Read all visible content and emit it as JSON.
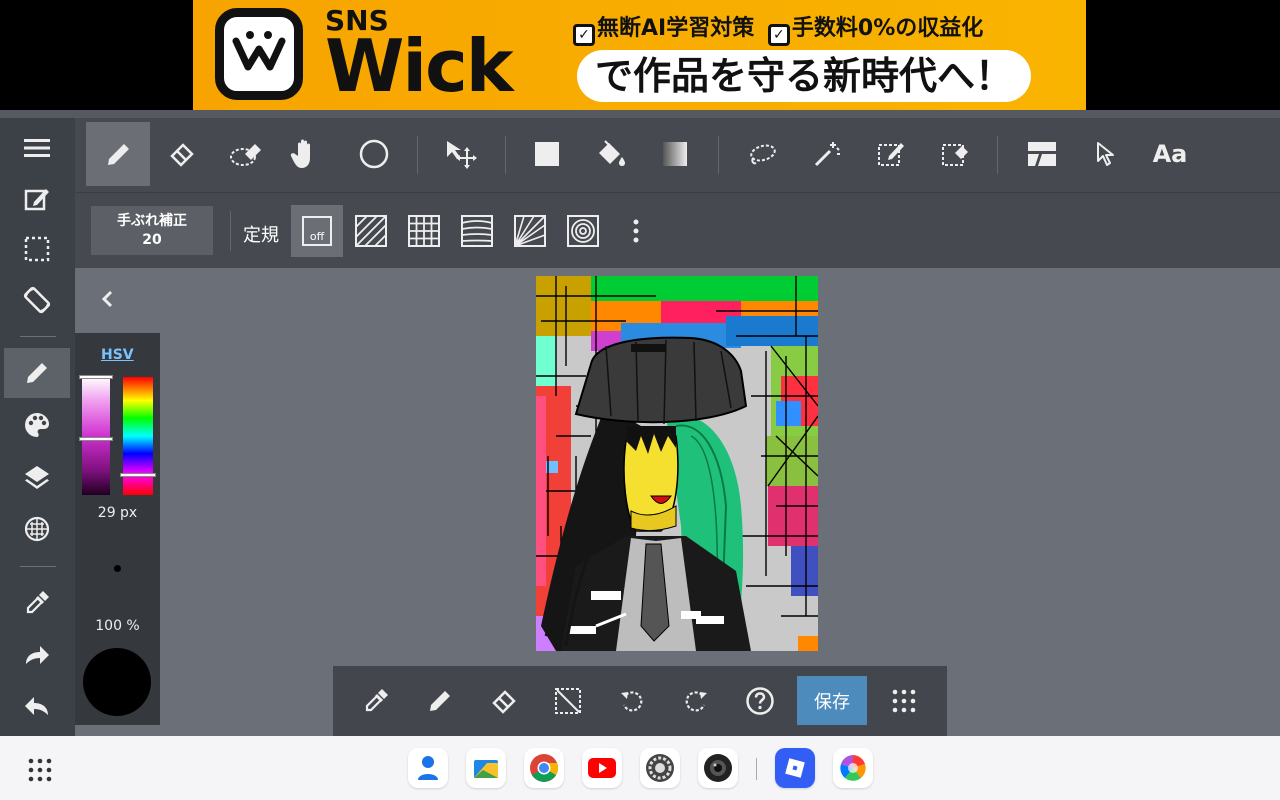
{
  "ad": {
    "sns": "SNS",
    "brand": "Wick",
    "tag_check1": "無断AI学習対策",
    "tag_check2": "手数料0%の収益化",
    "tagline": "で作品を守る新時代へ！"
  },
  "toolbar_top": {
    "text_tool_label": "Aa"
  },
  "toolbar_sub": {
    "stabilizer_label": "手ぶれ補正",
    "stabilizer_value": "20",
    "ruler_label": "定規",
    "ruler_off_label": "off"
  },
  "color_panel": {
    "mode_label": "HSV",
    "brush_size": "29 px",
    "opacity": "100 %",
    "current_color": "#000000"
  },
  "bottom_toolbar": {
    "save_label": "保存"
  },
  "colors": {
    "accent": "#4d8bbd",
    "toolbar_bg": "#46494f",
    "canvas_bg": "#6b6f77"
  },
  "icons": {
    "left": [
      "menu-icon",
      "edit-icon",
      "selection-icon",
      "rotate-screen-icon",
      "pencil-icon",
      "palette-icon",
      "layers-icon",
      "grid-icon",
      "eyedropper-icon",
      "redo-icon",
      "undo-icon"
    ],
    "top": [
      "pen-icon",
      "eraser-icon",
      "blur-icon",
      "hand-icon",
      "circle-icon",
      "move-icon",
      "rectangle-fill-icon",
      "bucket-icon",
      "gradient-icon",
      "lasso-icon",
      "magic-wand-icon",
      "select-pen-icon",
      "select-eraser-icon",
      "panel-icon",
      "pointer-icon",
      "text-icon"
    ]
  }
}
